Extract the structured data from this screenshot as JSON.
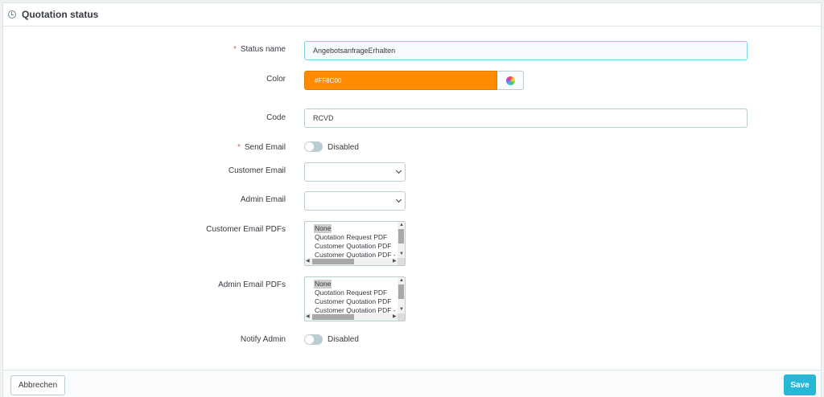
{
  "panel": {
    "title": "Quotation status"
  },
  "form": {
    "status_name": {
      "label": "Status name",
      "value": "AngebotsanfrageErhalten"
    },
    "color": {
      "label": "Color",
      "value": "#FF8C00",
      "swatch_color": "#ff8c00"
    },
    "code": {
      "label": "Code",
      "value": "RCVD"
    },
    "send_email": {
      "label": "Send Email",
      "state": "Disabled"
    },
    "customer_email": {
      "label": "Customer Email",
      "value": ""
    },
    "admin_email": {
      "label": "Admin Email",
      "value": ""
    },
    "customer_email_pdfs": {
      "label": "Customer Email PDFs",
      "options": [
        "None",
        "Quotation Request PDF",
        "Customer Quotation PDF",
        "Customer Quotation PDF - Cu"
      ],
      "selected": "None"
    },
    "admin_email_pdfs": {
      "label": "Admin Email PDFs",
      "options": [
        "None",
        "Quotation Request PDF",
        "Customer Quotation PDF",
        "Customer Quotation PDF - Cu"
      ],
      "selected": "None"
    },
    "notify_admin": {
      "label": "Notify Admin",
      "state": "Disabled"
    }
  },
  "footer": {
    "cancel_label": "Abbrechen",
    "save_label": "Save"
  },
  "icons": {
    "panel": "clock-icon",
    "color_picker": "color-wheel-icon",
    "select": "chevron-down-icon"
  },
  "colors": {
    "accent": "#25b9d7",
    "required": "#e25c4a"
  }
}
